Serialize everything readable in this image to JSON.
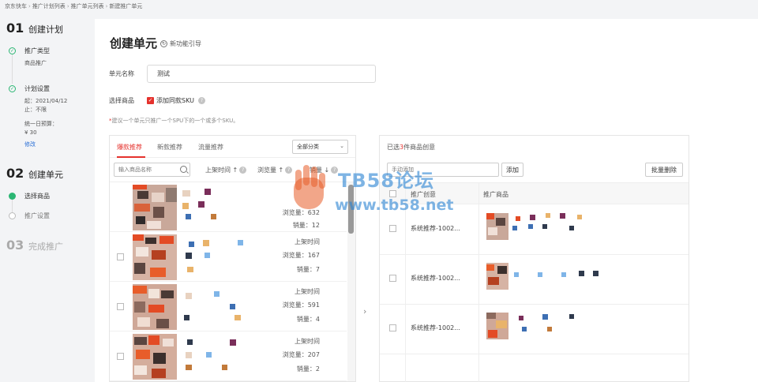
{
  "breadcrumb": [
    "京东快车",
    "推广计划列表",
    "推广单元列表",
    "新建推广单元"
  ],
  "steps": {
    "s1": {
      "num": "01",
      "title": "创建计划"
    },
    "s1_type_label": "推广类型",
    "s1_type_value": "商品推广",
    "s1_setting_label": "计划设置",
    "s1_start": "起：2021/04/12",
    "s1_end": "止：不限",
    "s1_budget_label": "统一日预算：",
    "s1_budget_value": "¥ 30",
    "s1_modify": "修改",
    "s2": {
      "num": "02",
      "title": "创建单元"
    },
    "s2_select": "选择商品",
    "s2_setting": "推广设置",
    "s3": {
      "num": "03",
      "title": "完成推广"
    }
  },
  "main": {
    "title": "创建单元",
    "guide": "新功能引导",
    "unit_name_label": "单元名称",
    "unit_name_value": "测试",
    "select_goods_label": "选择商品",
    "same_sku_label": "添加同款SKU",
    "tip": "建议一个单元只推广一个SPU下的一个或多个SKU。"
  },
  "product_panel": {
    "tabs": [
      "爆款推荐",
      "新款推荐",
      "流量推荐"
    ],
    "category": "全部分类",
    "search_placeholder": "输入商品名称",
    "sort_shelf": "上架时间 ↑",
    "sort_views": "浏览量 ↑",
    "sort_sales": "销量 ↓",
    "rows": [
      {
        "views": "浏览量：632",
        "sales": "销量：12"
      },
      {
        "shelf": "上架时间",
        "views": "浏览量：167",
        "sales": "销量：7"
      },
      {
        "shelf": "上架时间",
        "views": "浏览量：591",
        "sales": "销量：4"
      },
      {
        "shelf": "上架时间",
        "views": "浏览量：207",
        "sales": "销量：2"
      }
    ]
  },
  "selected_panel": {
    "count_prefix": "已选",
    "count": "3",
    "count_suffix": "件商品创意",
    "input_placeholder": "手动添加",
    "add_button": "添加",
    "batch_delete": "批量删除",
    "col_creative": "推广创意",
    "col_goods": "推广商品",
    "rows": [
      {
        "creative": "系统推荐-1002..."
      },
      {
        "creative": "系统推荐-1002..."
      },
      {
        "creative": "系统推荐-1002..."
      }
    ]
  },
  "watermark": {
    "line1": "TB58论坛",
    "line2": "www.tb58.net"
  },
  "colors": {
    "accent": "#e5322d",
    "success": "#2bb673",
    "link": "#2a6fd6"
  }
}
